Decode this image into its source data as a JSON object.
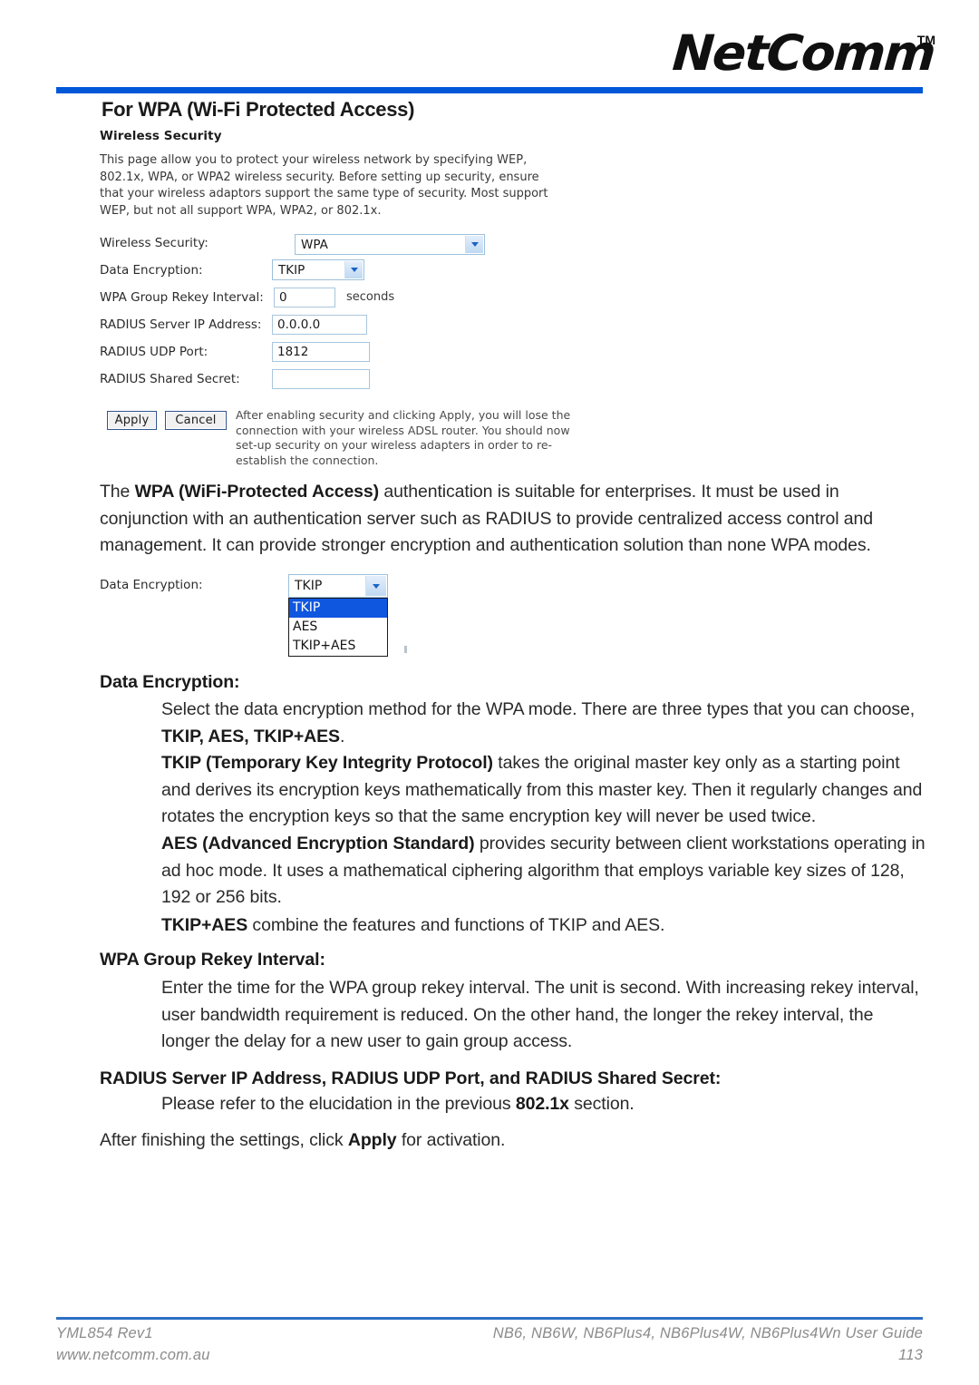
{
  "header": {
    "brand": "NetComm",
    "brand_tm": "TM",
    "page_title": "For WPA (Wi-Fi Protected Access)",
    "rule_color": "#0057d8"
  },
  "router_panel": {
    "heading": "Wireless Security",
    "description": "This page allow you to protect your wireless network by specifying WEP, 802.1x, WPA, or WPA2 wireless security. Before setting up security, ensure that your wireless adaptors support the same type of security. Most support WEP, but not all support WPA, WPA2, or 802.1x.",
    "fields": [
      {
        "label": "Wireless Security:",
        "value": "WPA",
        "type": "select"
      },
      {
        "label": "Data Encryption:",
        "value": "TKIP",
        "type": "select"
      },
      {
        "label": "WPA Group Rekey Interval:",
        "value": "0",
        "type": "text",
        "unit": "seconds"
      },
      {
        "label": "RADIUS Server IP Address:",
        "value": "0.0.0.0",
        "type": "text"
      },
      {
        "label": "RADIUS UDP Port:",
        "value": "1812",
        "type": "text"
      },
      {
        "label": "RADIUS Shared Secret:",
        "value": "",
        "type": "text"
      }
    ],
    "apply_label": "Apply",
    "cancel_label": "Cancel",
    "button_note": "After enabling security and clicking Apply, you will lose the connection with your wireless ADSL router. You should now set-up security on your wireless adapters in order to re-establish the connection."
  },
  "dropdown_panel": {
    "label": "Data Encryption:",
    "selected": "TKIP",
    "options": [
      "TKIP",
      "AES",
      "TKIP+AES"
    ],
    "highlight_color": "#1057e0"
  },
  "body": {
    "intro_p1_a": "The ",
    "intro_p1_b": "WPA (WiFi-Protected Access)",
    "intro_p1_c": " authentication is suitable for enterprises. It must be used in conjunction with an authentication server such as RADIUS to provide centralized access control and management. It can provide stronger encryption and authentication solution than none WPA modes.",
    "data_encryption_heading": "Data Encryption:",
    "data_encryption_p1_a": "Select the data encryption method for the WPA mode. There are three types that you can choose, ",
    "data_encryption_p1_b": "TKIP, AES, TKIP+AES",
    "data_encryption_p1_c": ".",
    "tkip_b": "TKIP (Temporary Key Integrity Protocol)",
    "tkip_rest": " takes the original master key only as a starting point and derives its encryption keys mathematically from this master key. Then it regularly changes and rotates the encryption keys so that the same encryption key will never be used twice.",
    "aes_b": "AES (Advanced Encryption Standard)",
    "aes_rest": " provides security between client workstations operating in ad hoc mode. It uses a mathematical ciphering algorithm that employs variable key sizes of 128, 192 or 256 bits.",
    "tkipaes_b": "TKIP+AES",
    "tkipaes_rest": " combine the features and functions of TKIP and AES.",
    "rekey_heading": "WPA Group Rekey Interval:",
    "rekey_p": "Enter the time for the WPA group rekey interval. The unit is second. With increasing rekey interval, user bandwidth requirement is reduced. On the other hand, the longer the rekey interval, the longer the delay for a new user to gain group access.",
    "radius_heading": "RADIUS Server IP Address, RADIUS UDP Port, and RADIUS Shared Secret:",
    "radius_p_a": "Please refer to the elucidation in the previous ",
    "radius_p_b": "802.1x",
    "radius_p_c": " section.",
    "closing_a": "After finishing the settings, click ",
    "closing_b": "Apply",
    "closing_c": " for activation."
  },
  "footer": {
    "left_line1": "YML854 Rev1",
    "left_line2": "www.netcomm.com.au",
    "right_line1": "NB6, NB6W, NB6Plus4, NB6Plus4W, NB6Plus4Wn User Guide",
    "right_line2": "113"
  }
}
